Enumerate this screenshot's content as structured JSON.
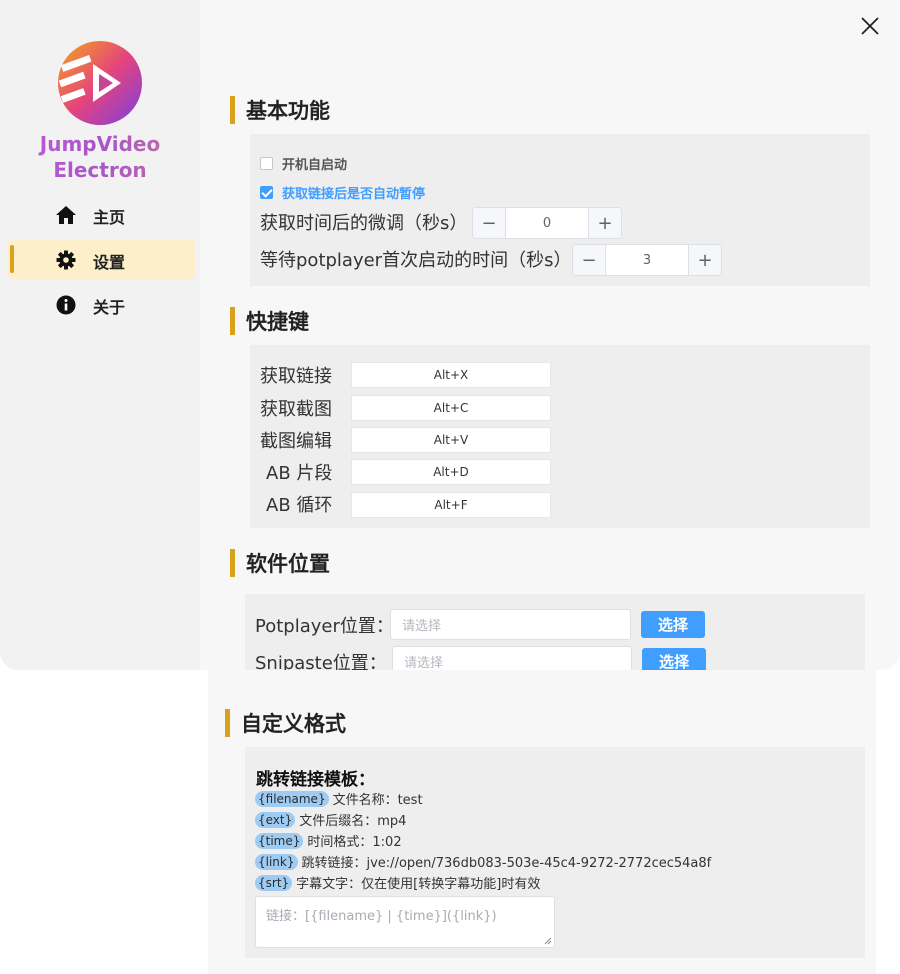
{
  "app": {
    "brand_line1": "JumpVideo",
    "brand_line2": "Electron",
    "accent": "#d8a21a",
    "primary": "#409eff"
  },
  "sidebar": {
    "items": [
      {
        "label": "主页",
        "icon": "home-icon",
        "active": false
      },
      {
        "label": "设置",
        "icon": "gear-icon",
        "active": true
      },
      {
        "label": "关于",
        "icon": "info-icon",
        "active": false
      }
    ]
  },
  "basic": {
    "title": "基本功能",
    "autostart_label": "开机自启动",
    "autostart_checked": false,
    "autopause_label": "获取链接后是否自动暂停",
    "autopause_checked": true,
    "finetune_label": "获取时间后的微调（秒s）",
    "finetune_value": "0",
    "wait_label": "等待potplayer首次启动的时间（秒s）",
    "wait_value": "3",
    "minus": "−",
    "plus": "+"
  },
  "hotkeys": {
    "title": "快捷键",
    "items": [
      {
        "label": "获取链接",
        "value": "Alt+X"
      },
      {
        "label": "获取截图",
        "value": "Alt+C"
      },
      {
        "label": "截图编辑",
        "value": "Alt+V"
      },
      {
        "label": "AB 片段",
        "value": "Alt+D"
      },
      {
        "label": "AB 循环",
        "value": "Alt+F"
      }
    ]
  },
  "software": {
    "title": "软件位置",
    "potplayer_label": "Potplayer位置：",
    "snipaste_label": "Snipaste位置：",
    "placeholder": "请选择",
    "pick_label": "选择"
  },
  "format": {
    "title": "自定义格式",
    "template_title": "跳转链接模板：",
    "vars": [
      {
        "tag": "{filename}",
        "text": "文件名称：test"
      },
      {
        "tag": "{ext}",
        "text": "文件后缀名：mp4"
      },
      {
        "tag": "{time}",
        "text": "时间格式：1:02"
      },
      {
        "tag": "{link}",
        "text": "跳转链接：jve://open/736db083-503e-45c4-9272-2772cec54a8f"
      },
      {
        "tag": "{srt}",
        "text": "字幕文字：仅在使用[转换字幕功能]时有效"
      }
    ],
    "template_value": "链接：[{filename} | {time}]({link})"
  }
}
